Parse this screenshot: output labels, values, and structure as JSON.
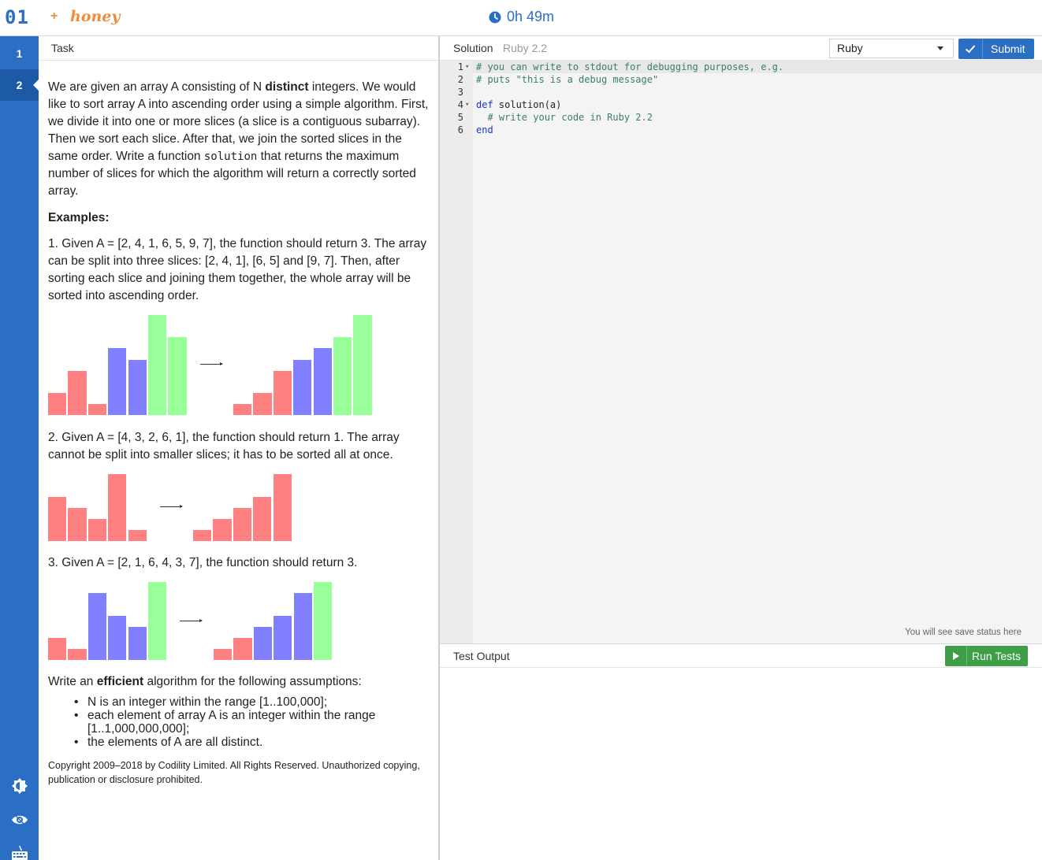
{
  "topbar": {
    "logo": "01",
    "plus": "+",
    "brand": "honey",
    "timer": "0h 49m",
    "timer_icon": "clock-icon"
  },
  "rail": {
    "items": [
      {
        "label": "1"
      },
      {
        "label": "2"
      }
    ],
    "icons": [
      "brightness-icon",
      "eye-icon",
      "keyboard-icon"
    ]
  },
  "task": {
    "header": "Task",
    "intro_1": "We are given an array A consisting of N ",
    "intro_bold": "distinct",
    "intro_2": " integers. We would like to sort array A into ascending order using a simple algorithm. First, we divide it into one or more slices (a slice is a contiguous subarray). Then we sort each slice. After that, we join the sorted slices in the same order. Write a function ",
    "intro_code": "solution",
    "intro_3": " that returns the maximum number of slices for which the algorithm will return a correctly sorted array.",
    "examples_heading": "Examples:",
    "example_1": "1. Given A = [2, 4, 1, 6, 5, 9, 7], the function should return 3. The array can be split into three slices: [2, 4, 1], [6, 5] and [9, 7]. Then, after sorting each slice and joining them together, the whole array will be sorted into ascending order.",
    "example_2": "2. Given A = [4, 3, 2, 6, 1], the function should return 1. The array cannot be split into smaller slices; it has to be sorted all at once.",
    "example_3": "3. Given A = [2, 1, 6, 4, 3, 7], the function should return 3.",
    "efficient_1": "Write an ",
    "efficient_bold": "efficient",
    "efficient_2": " algorithm for the following assumptions:",
    "assumptions": [
      "N is an integer within the range [1..100,000];",
      "each element of array A is an integer within the range [1..1,000,000,000];",
      "the elements of A are all distinct."
    ],
    "copyright": "Copyright 2009–2018 by Codility Limited. All Rights Reserved. Unauthorized copying, publication or disclosure prohibited.",
    "slice_colors": {
      "red": "#ff8080",
      "blue": "#8080ff",
      "green": "#99ff99"
    },
    "figures": [
      {
        "before": {
          "values": [
            2,
            4,
            1,
            6,
            5,
            9,
            7
          ],
          "slices": [
            "red",
            "red",
            "red",
            "blue",
            "blue",
            "green",
            "green"
          ]
        },
        "after": {
          "values": [
            1,
            2,
            4,
            5,
            6,
            7,
            9
          ],
          "slices": [
            "red",
            "red",
            "red",
            "blue",
            "blue",
            "green",
            "green"
          ]
        }
      },
      {
        "before": {
          "values": [
            4,
            3,
            2,
            6,
            1
          ],
          "slices": [
            "red",
            "red",
            "red",
            "red",
            "red"
          ]
        },
        "after": {
          "values": [
            1,
            2,
            3,
            4,
            6
          ],
          "slices": [
            "red",
            "red",
            "red",
            "red",
            "red"
          ]
        }
      },
      {
        "before": {
          "values": [
            2,
            1,
            6,
            4,
            3,
            7
          ],
          "slices": [
            "red",
            "red",
            "blue",
            "blue",
            "blue",
            "green"
          ]
        },
        "after": {
          "values": [
            1,
            2,
            3,
            4,
            6,
            7
          ],
          "slices": [
            "red",
            "red",
            "blue",
            "blue",
            "blue",
            "green"
          ]
        }
      }
    ]
  },
  "solution": {
    "title": "Solution",
    "language_version": "Ruby 2.2",
    "language_selected": "Ruby",
    "submit_label": "Submit",
    "code_lines": [
      {
        "n": "1",
        "fold": true,
        "parts": [
          {
            "t": "# you can write to stdout for debugging purposes, e.g.",
            "c": "comment"
          }
        ]
      },
      {
        "n": "2",
        "fold": false,
        "parts": [
          {
            "t": "# puts \"this is a debug message\"",
            "c": "comment"
          }
        ]
      },
      {
        "n": "3",
        "fold": false,
        "parts": [
          {
            "t": "",
            "c": "plain"
          }
        ]
      },
      {
        "n": "4",
        "fold": true,
        "parts": [
          {
            "t": "def",
            "c": "kw"
          },
          {
            "t": " solution(a)",
            "c": "plain"
          }
        ]
      },
      {
        "n": "5",
        "fold": false,
        "parts": [
          {
            "t": "  # write your code in Ruby 2.2",
            "c": "comment"
          }
        ]
      },
      {
        "n": "6",
        "fold": false,
        "parts": [
          {
            "t": "end",
            "c": "kw"
          }
        ]
      }
    ],
    "save_status": "You will see save status here"
  },
  "output": {
    "title": "Test Output",
    "run_label": "Run Tests"
  }
}
